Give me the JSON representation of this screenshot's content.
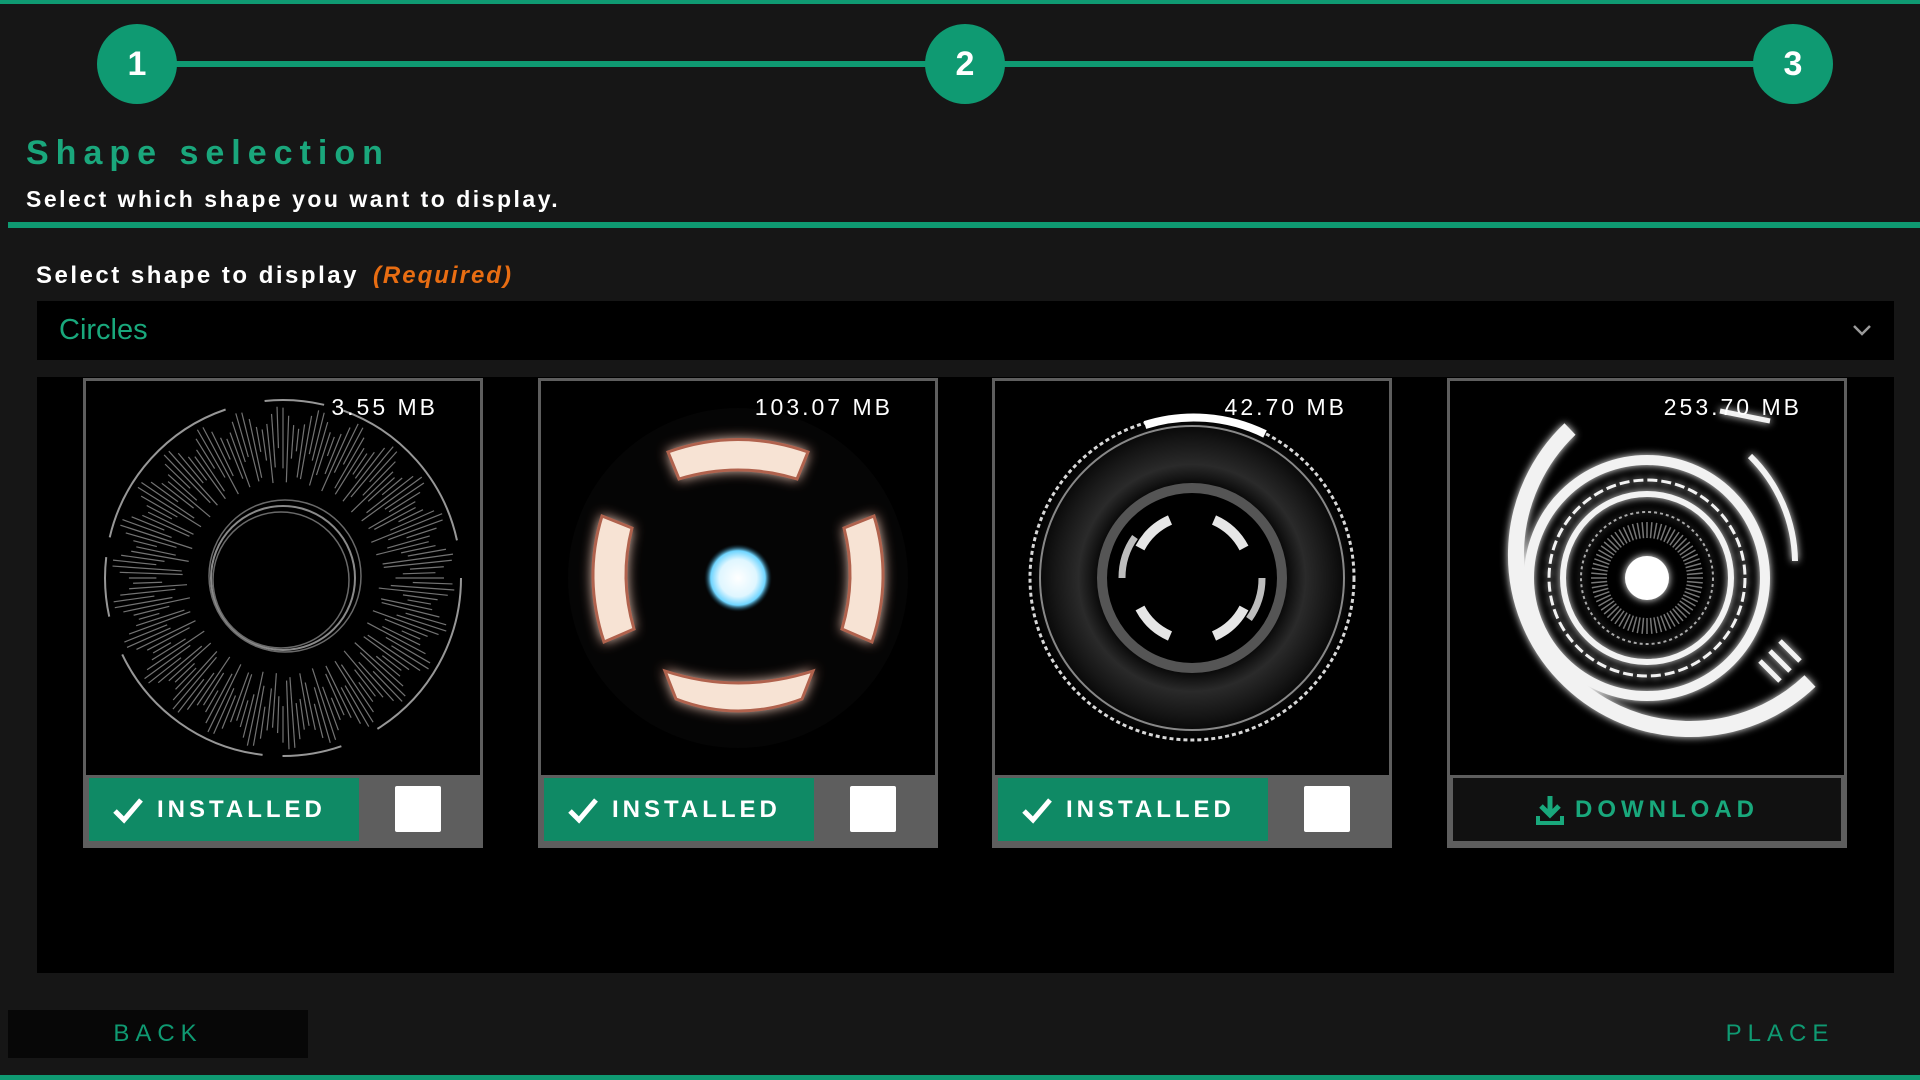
{
  "stepper": {
    "steps": [
      {
        "label": "1"
      },
      {
        "label": "2"
      },
      {
        "label": "3"
      }
    ]
  },
  "header": {
    "title": "Shape selection",
    "subtitle": "Select which shape you want to display."
  },
  "form": {
    "field_label": "Select shape to display",
    "required_label": "(Required)",
    "selected_value": "Circles"
  },
  "cards": [
    {
      "size": "3.55 MB",
      "status": "INSTALLED",
      "checked": false
    },
    {
      "size": "103.07 MB",
      "status": "INSTALLED",
      "checked": false
    },
    {
      "size": "42.70 MB",
      "status": "INSTALLED",
      "checked": false
    },
    {
      "size": "253.70 MB",
      "status": "DOWNLOAD",
      "checked": false
    }
  ],
  "footer": {
    "back_label": "BACK",
    "place_label": "PLACE"
  },
  "colors": {
    "accent": "#0f9a72",
    "required": "#e86d12",
    "background": "#161616"
  }
}
